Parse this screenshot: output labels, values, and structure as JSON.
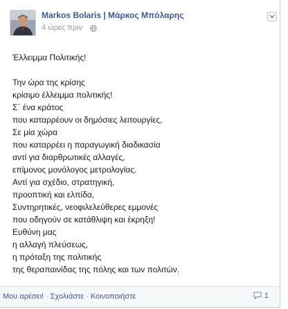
{
  "post": {
    "author": "Markos Bolaris | Μάρκος Μπόλαρης",
    "timestamp": "4 ώρες πριν",
    "audience_icon": "globe-icon",
    "menu_icon": "chevron-down-icon",
    "title": "Έλλειμμα Πολιτικής!",
    "lines": [
      "Την ώρα της κρίσης",
      "κρίσιμο έλλειμμα πολιτικής!",
      "Σ΄ ένα κράτος",
      "που καταρρέουν οι δημόσιες λειτουργίες,",
      "Σε μία χώρα",
      "που καταρρέει η παραγωγική διαδικασία",
      "αντί για διαρθρωτικές αλλαγές,",
      "επίμονος μονόλογος μετρολογίας.",
      "Αντί για σχέδιο, στρατηγική,",
      "προοπτική και ελπίδα,",
      "Συντηρητικές, νεοφιλελεύθερες εμμονές",
      "που οδηγούν σε κατάθλιψη και έκρηξη!",
      "Ευθύνη μας",
      "η αλλαγή πλεύσεως,",
      "η πρόταξη της πολιτικής",
      "της θεραπαινίδας της πόλης και των πολιτών."
    ]
  },
  "actions": {
    "like": "Μου αρέσει!",
    "comment": "Σχολιάστε",
    "share": "Κοινοποιήστε",
    "separator": "·",
    "comment_count": "1",
    "comment_icon": "speech-bubble-icon"
  },
  "colors": {
    "link": "#3b5998",
    "text": "#141823",
    "muted": "#90949c"
  }
}
